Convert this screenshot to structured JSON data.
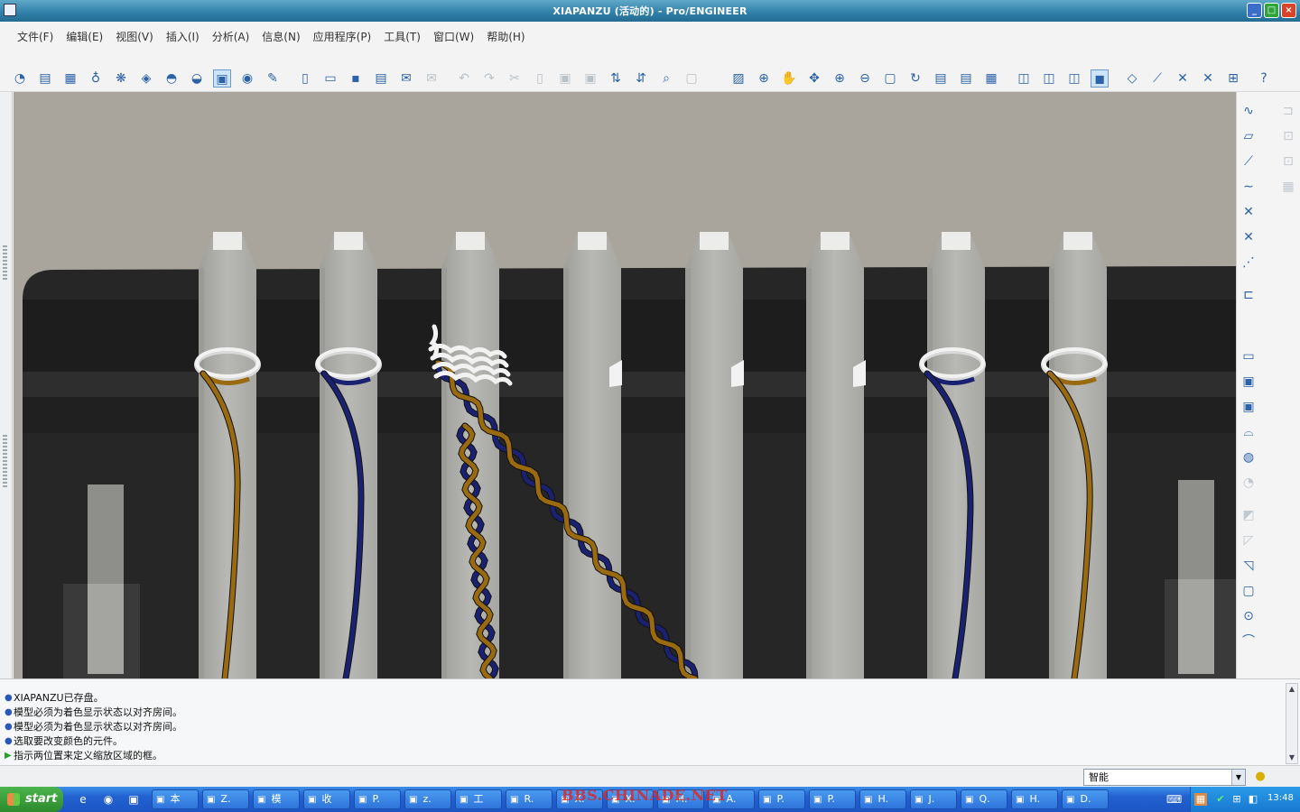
{
  "window": {
    "title": "XIAPANZU (活动的) - Pro/ENGINEER",
    "buttons": {
      "minimize": "_",
      "maximize": "□",
      "close": "×"
    }
  },
  "menu": [
    {
      "label": "文件(F)"
    },
    {
      "label": "编辑(E)"
    },
    {
      "label": "视图(V)"
    },
    {
      "label": "插入(I)"
    },
    {
      "label": "分析(A)"
    },
    {
      "label": "信息(N)"
    },
    {
      "label": "应用程序(P)"
    },
    {
      "label": "工具(T)"
    },
    {
      "label": "窗口(W)"
    },
    {
      "label": "帮助(H)"
    }
  ],
  "toolbar_icons": [
    "color-appearance-icon",
    "scene-icon",
    "texture-icon",
    "light-icon",
    "room-icon",
    "environment-icon",
    "render-setup-icon",
    "render-icon",
    "render-region-icon",
    "photo-render-icon",
    "brush-icon",
    "new-file-icon",
    "open-file-icon",
    "save-icon",
    "print-icon",
    "email-icon",
    "email-attach-icon",
    "undo-icon",
    "redo-icon",
    "cut-icon",
    "copy-icon",
    "paste-icon",
    "paste-special-icon",
    "regenerate-icon",
    "regenerate-manager-icon",
    "find-icon",
    "selection-filter-icon",
    "repaint-icon",
    "spin-center-icon",
    "orient-icon",
    "pan-icon",
    "zoom-in-icon",
    "zoom-out-icon",
    "refit-icon",
    "reorient-icon",
    "saved-views-icon",
    "layers-icon",
    "view-manager-icon",
    "wireframe-icon",
    "hidden-line-icon",
    "no-hidden-icon",
    "shading-icon",
    "datum-planes-icon",
    "datum-axes-icon",
    "datum-points-icon",
    "csys-icon",
    "annotation-icon",
    "context-help-icon"
  ],
  "right_toolbar_icons": [
    "sketched-datum-curve-icon",
    "datum-plane-icon",
    "datum-axis-icon",
    "datum-curve-icon",
    "datum-point-icon",
    "sketched-point-icon",
    "offset-point-icon",
    "csys-icon",
    "analysis-feature-icon",
    "insert-component-icon",
    "copy-component-icon",
    "mirror-icon",
    "merge-icon",
    "round-icon",
    "chamfer-icon",
    "draft-icon",
    "rib-icon",
    "shell-icon",
    "hole-icon",
    "sweep-icon"
  ],
  "messages": [
    {
      "kind": "info",
      "text": "XIAPANZU已存盘。"
    },
    {
      "kind": "info",
      "text": "模型必须为着色显示状态以对齐房间。"
    },
    {
      "kind": "info",
      "text": "模型必须为着色显示状态以对齐房间。"
    },
    {
      "kind": "info",
      "text": "选取要改变颜色的元件。"
    },
    {
      "kind": "prompt",
      "text": "指示两位置来定义缩放区域的框。"
    }
  ],
  "status": {
    "filter_value": "智能"
  },
  "taskbar": {
    "start_label": "start",
    "tasks": [
      {
        "label": "本"
      },
      {
        "label": "Z."
      },
      {
        "label": "模"
      },
      {
        "label": "收"
      },
      {
        "label": "P."
      },
      {
        "label": "z."
      },
      {
        "label": "工"
      },
      {
        "label": "R."
      },
      {
        "label": "X."
      },
      {
        "label": "X."
      },
      {
        "label": "M."
      },
      {
        "label": "A."
      },
      {
        "label": "P."
      },
      {
        "label": "P."
      },
      {
        "label": "H."
      },
      {
        "label": "J."
      },
      {
        "label": "Q."
      },
      {
        "label": "H."
      },
      {
        "label": "D."
      }
    ],
    "clock": "13:48"
  },
  "watermark": "BBS.CHINADE.NET",
  "colors": {
    "viewport_bg": "#a9a59c",
    "housing": "#232323",
    "pin": "#b3b3b0",
    "wire_blue": "#1a2170",
    "wire_gold": "#9a6a10",
    "wire_white": "#f2f2f2"
  }
}
